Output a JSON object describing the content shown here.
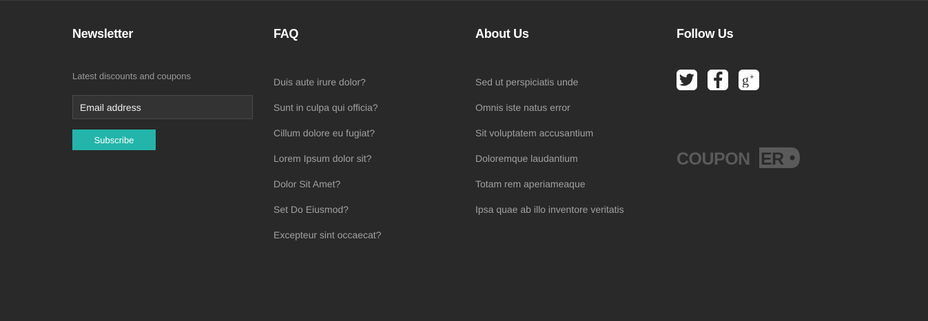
{
  "newsletter": {
    "heading": "Newsletter",
    "description": "Latest discounts and coupons",
    "email_placeholder": "Email address",
    "subscribe_label": "Subscribe"
  },
  "faq": {
    "heading": "FAQ",
    "items": [
      "Duis aute irure dolor?",
      "Sunt in culpa qui officia?",
      "Cillum dolore eu fugiat?",
      "Lorem Ipsum dolor sit?",
      "Dolor Sit Amet?",
      "Set Do Eiusmod?",
      "Excepteur sint occaecat?"
    ]
  },
  "about": {
    "heading": "About Us",
    "items": [
      "Sed ut perspiciatis unde",
      "Omnis iste natus error",
      "Sit voluptatem accusantium",
      "Doloremque laudantium",
      "Totam rem aperiameaque",
      "Ipsa quae ab illo inventore veritatis"
    ]
  },
  "follow": {
    "heading": "Follow Us",
    "icons": [
      "twitter-icon",
      "facebook-icon",
      "google-plus-icon"
    ]
  },
  "logo": {
    "text_main": "COUPON",
    "text_tag": "ER"
  },
  "colors": {
    "background": "#292929",
    "accent": "#23b5aa",
    "heading": "#ffffff",
    "link": "#a0a0a0",
    "logo": "#5a5a5a"
  }
}
